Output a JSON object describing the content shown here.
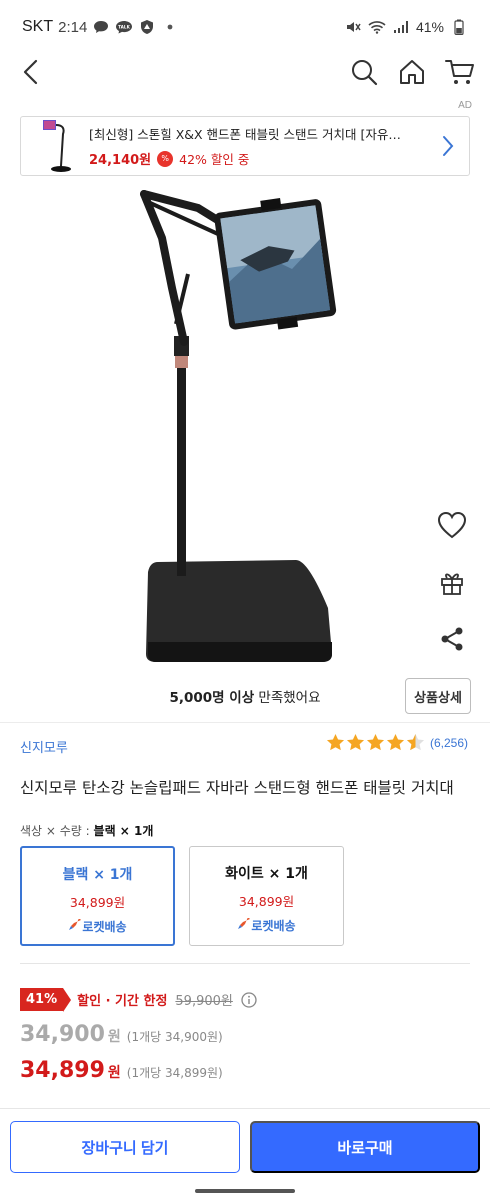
{
  "status_bar": {
    "carrier": "SKT",
    "time": "2:14",
    "battery": "41%",
    "icons_left": [
      "chat-bubble-icon",
      "talk-icon",
      "shield-icon",
      "dot-icon"
    ],
    "icons_right": [
      "mute-icon",
      "wifi-icon",
      "signal-icon",
      "battery-icon"
    ]
  },
  "nav": {
    "icons": [
      "back-arrow-icon",
      "search-icon",
      "home-icon",
      "cart-icon"
    ]
  },
  "ad": {
    "label": "AD",
    "title": "[최신형] 스톤힐 X&X 핸드폰 태블릿 스탠드 거치대 [자유…",
    "price": "24,140원",
    "badge": "%",
    "discount": "42% 할인 중"
  },
  "product": {
    "buyers_prefix": "5,000명 이상",
    "buyers_suffix": " 만족했어요",
    "detail_button": "상품상세",
    "brand": "신지모루",
    "rating": 4.5,
    "review_count": "(6,256)",
    "title": "신지모루 탄소강 논슬립패드 자바라 스탠드형 핸드폰 태블릿 거치대"
  },
  "options": {
    "label": "색상 × 수량 : ",
    "selected_value": "블랙 × 1개",
    "items": [
      {
        "name": "블랙 × 1개",
        "price": "34,899원",
        "delivery": "로켓배송"
      },
      {
        "name": "화이트 × 1개",
        "price": "34,899원",
        "delivery": "로켓배송"
      }
    ]
  },
  "pricing": {
    "discount_badge": "41%",
    "discount_text": "할인 · 기간 한정",
    "original_price": "59,900원",
    "sale_price_grey": "34,900",
    "sale_price_grey_unit": "원",
    "sale_price_grey_per": "(1개당 34,900원)",
    "final_price": "34,899",
    "final_price_unit": "원",
    "final_price_per": "(1개당 34,899원)"
  },
  "bottom_bar": {
    "cart_button": "장바구니 담기",
    "buy_button": "바로구매"
  },
  "colors": {
    "accent_blue": "#346aff",
    "link_blue": "#3a75d4",
    "price_red": "#d21a1a",
    "star": "#f5a623"
  }
}
